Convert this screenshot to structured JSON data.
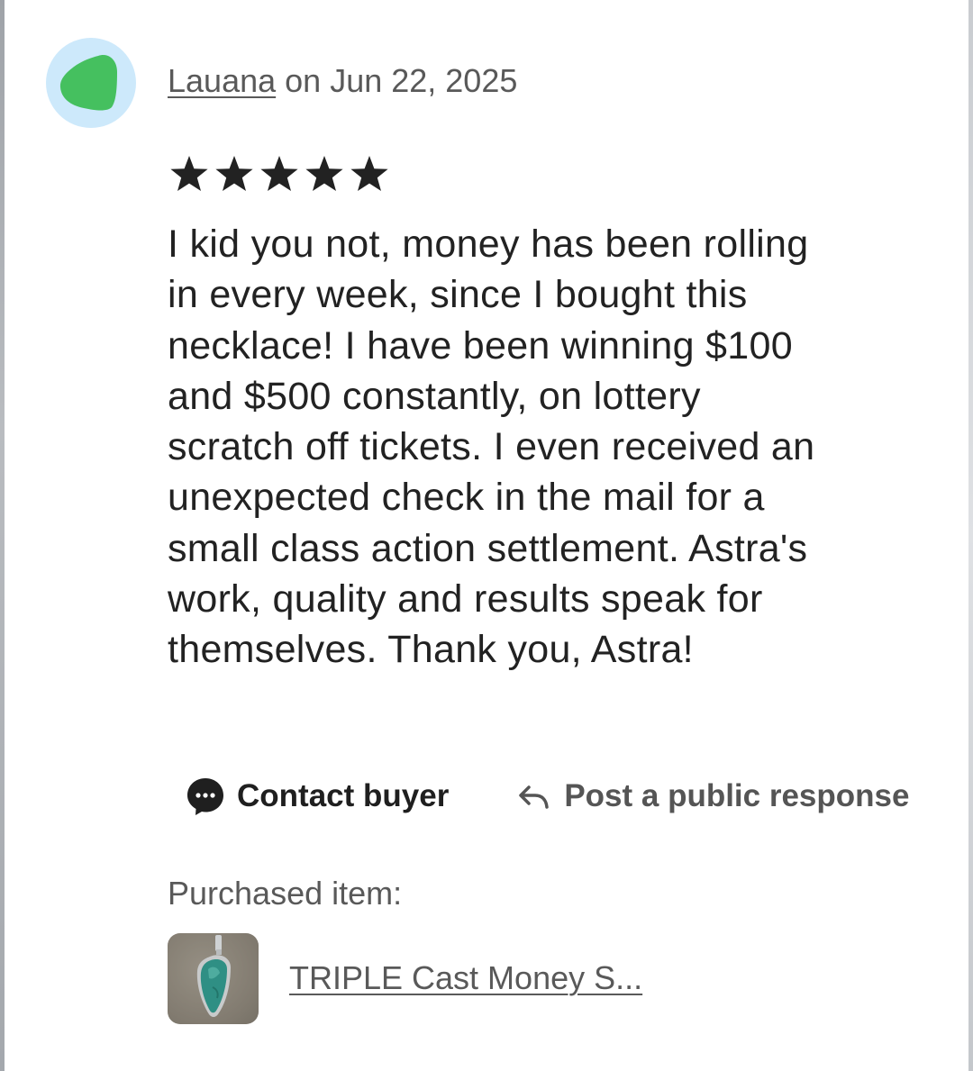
{
  "review": {
    "reviewer_name": "Lauana",
    "date_text": " on Jun 22, 2025",
    "rating": 5,
    "text": "I kid you not, money has been rolling\nin every week, since I bought this\nnecklace! I have been winning $100\nand $500 constantly, on lottery\nscratch off tickets. I even received an\nunexpected check in the mail for a\nsmall class action settlement. Astra's\nwork, quality and results speak for\nthemselves. Thank you, Astra!"
  },
  "actions": {
    "contact_label": "Contact buyer",
    "respond_label": "Post a public response"
  },
  "purchased": {
    "label": "Purchased item:",
    "item_title": "TRIPLE Cast Money S..."
  },
  "colors": {
    "avatar_bg": "#cde9fb",
    "avatar_shape": "#45c05f",
    "star": "#222222",
    "muted_text": "#595959"
  },
  "icons": {
    "avatar": "green-leaf-avatar-icon",
    "contact": "chat-bubble-icon",
    "respond": "reply-arrow-icon",
    "star": "star-icon"
  }
}
